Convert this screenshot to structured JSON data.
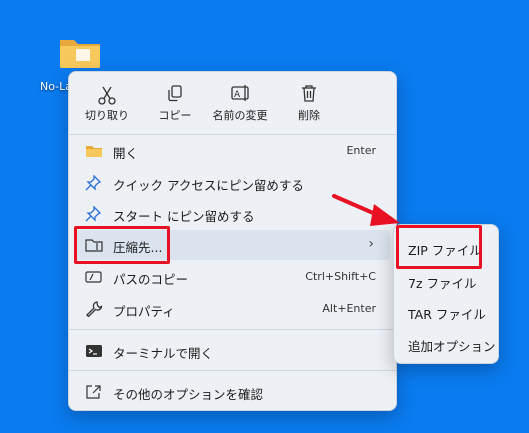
{
  "desktop": {
    "icon_label": "No-La",
    "background": "#0a7bf0"
  },
  "context_menu": {
    "quick_actions": [
      {
        "label": "切り取り",
        "icon": "scissors-icon"
      },
      {
        "label": "コピー",
        "icon": "copy-icon"
      },
      {
        "label": "名前の変更",
        "icon": "rename-icon"
      },
      {
        "label": "削除",
        "icon": "trash-icon"
      }
    ],
    "items": [
      {
        "label": "開く",
        "shortcut": "Enter",
        "icon": "folder-open-icon"
      },
      {
        "label": "クイック アクセスにピン留めする",
        "shortcut": "",
        "icon": "pin-icon"
      },
      {
        "label": "スタート にピン留めする",
        "shortcut": "",
        "icon": "pin-icon"
      },
      {
        "label": "圧縮先...",
        "shortcut": "",
        "icon": "zip-folder-icon",
        "has_submenu": true
      },
      {
        "label": "パスのコピー",
        "shortcut": "Ctrl+Shift+C",
        "icon": "path-copy-icon"
      },
      {
        "label": "プロパティ",
        "shortcut": "Alt+Enter",
        "icon": "wrench-icon"
      },
      {
        "label": "ターミナルで開く",
        "shortcut": "",
        "icon": "terminal-icon"
      },
      {
        "label": "その他のオプションを確認",
        "shortcut": "",
        "icon": "share-icon"
      }
    ]
  },
  "submenu": {
    "items": [
      {
        "label": "ZIP ファイル"
      },
      {
        "label": "7z ファイル"
      },
      {
        "label": "TAR ファイル"
      },
      {
        "label": "追加オプション"
      }
    ]
  },
  "colors": {
    "highlight": "#e81123",
    "menu_bg": "#edf1f6",
    "accent": "#0a7bf0"
  }
}
